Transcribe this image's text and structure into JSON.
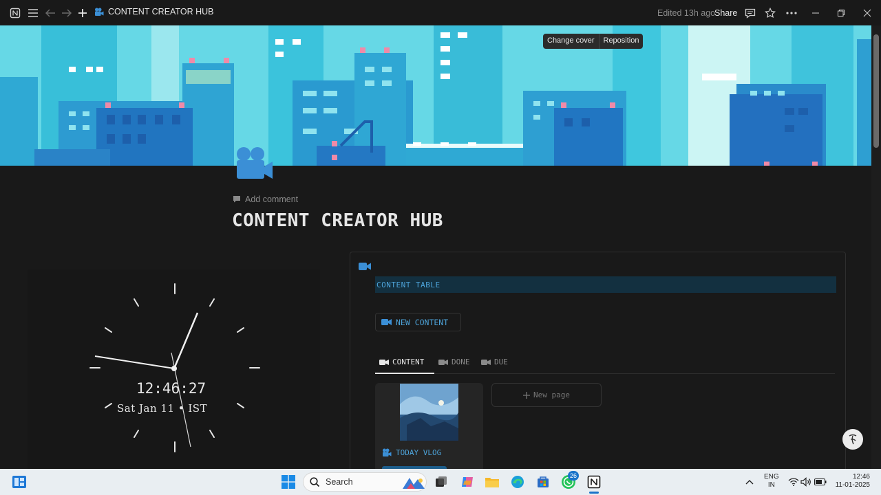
{
  "topbar": {
    "page_title": "CONTENT CREATOR HUB",
    "edited": "Edited 13h ago",
    "share": "Share"
  },
  "cover": {
    "change_cover": "Change cover",
    "reposition": "Reposition"
  },
  "page": {
    "add_comment": "Add comment",
    "title": "CONTENT CREATOR HUB"
  },
  "clock": {
    "time": "12:46:27",
    "date": "Sat Jan 11 • IST"
  },
  "database": {
    "title": "CONTENT TABLE",
    "new_button": "NEW CONTENT",
    "tabs": [
      {
        "label": "CONTENT",
        "active": true
      },
      {
        "label": "DONE",
        "active": false
      },
      {
        "label": "DUE",
        "active": false
      }
    ],
    "cards": [
      {
        "title": "TODAY VLOG"
      }
    ],
    "new_page": "New page"
  },
  "taskbar": {
    "search_placeholder": "Search",
    "lang_line1": "ENG",
    "lang_line2": "IN",
    "time": "12:46",
    "date": "11-01-2025",
    "whatsapp_badge": "26"
  },
  "colors": {
    "accent_blue": "#4da3d9",
    "cover_cyan": "#4fd2e0",
    "background": "#191919"
  }
}
